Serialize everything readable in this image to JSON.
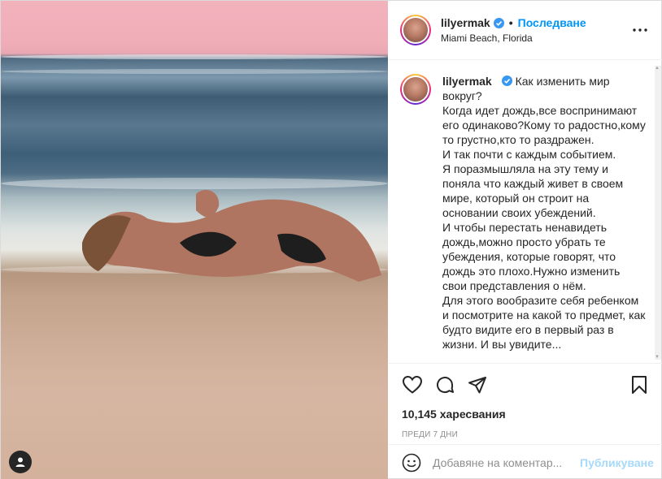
{
  "post": {
    "username": "lilyermak",
    "follow_label": "Последване",
    "dot": "•",
    "location": "Miami Beach, Florida"
  },
  "caption": {
    "username": "lilyermak",
    "lines": [
      "Как изменить мир вокруг?",
      "Когда идет дождь,все воспринимают его одинаково?Кому то радостно,кому то грустно,кто то раздражен.",
      "И так почти с каждым событием.",
      "Я поразмышляла на эту тему и поняла что каждый живет в своем мире, который он строит на основании своих убеждений.",
      "И чтобы перестать ненавидеть дождь,можно просто убрать те убеждения, которые говорят, что дождь это плохо.Нужно изменить свои представления о нём.",
      "Для этого вообразите себя ребенком и посмотрите на какой то предмет, как будто видите его в первый раз в жизни. И вы увидите..."
    ]
  },
  "stats": {
    "likes": "10,145 харесвания",
    "age": "ПРЕДИ 7 ДНИ"
  },
  "comment": {
    "placeholder": "Добавяне на коментар...",
    "publish_label": "Публикуване"
  },
  "icons": {
    "verified": "verified-badge-icon",
    "more": "more-options-icon",
    "like": "heart-icon",
    "comment": "comment-icon",
    "share": "share-icon",
    "save": "bookmark-icon",
    "emoji": "emoji-icon",
    "tag": "user-tag-icon"
  },
  "colors": {
    "accent": "#0095f6",
    "text": "#262626",
    "muted": "#8e8e8e",
    "border": "#efefef"
  }
}
